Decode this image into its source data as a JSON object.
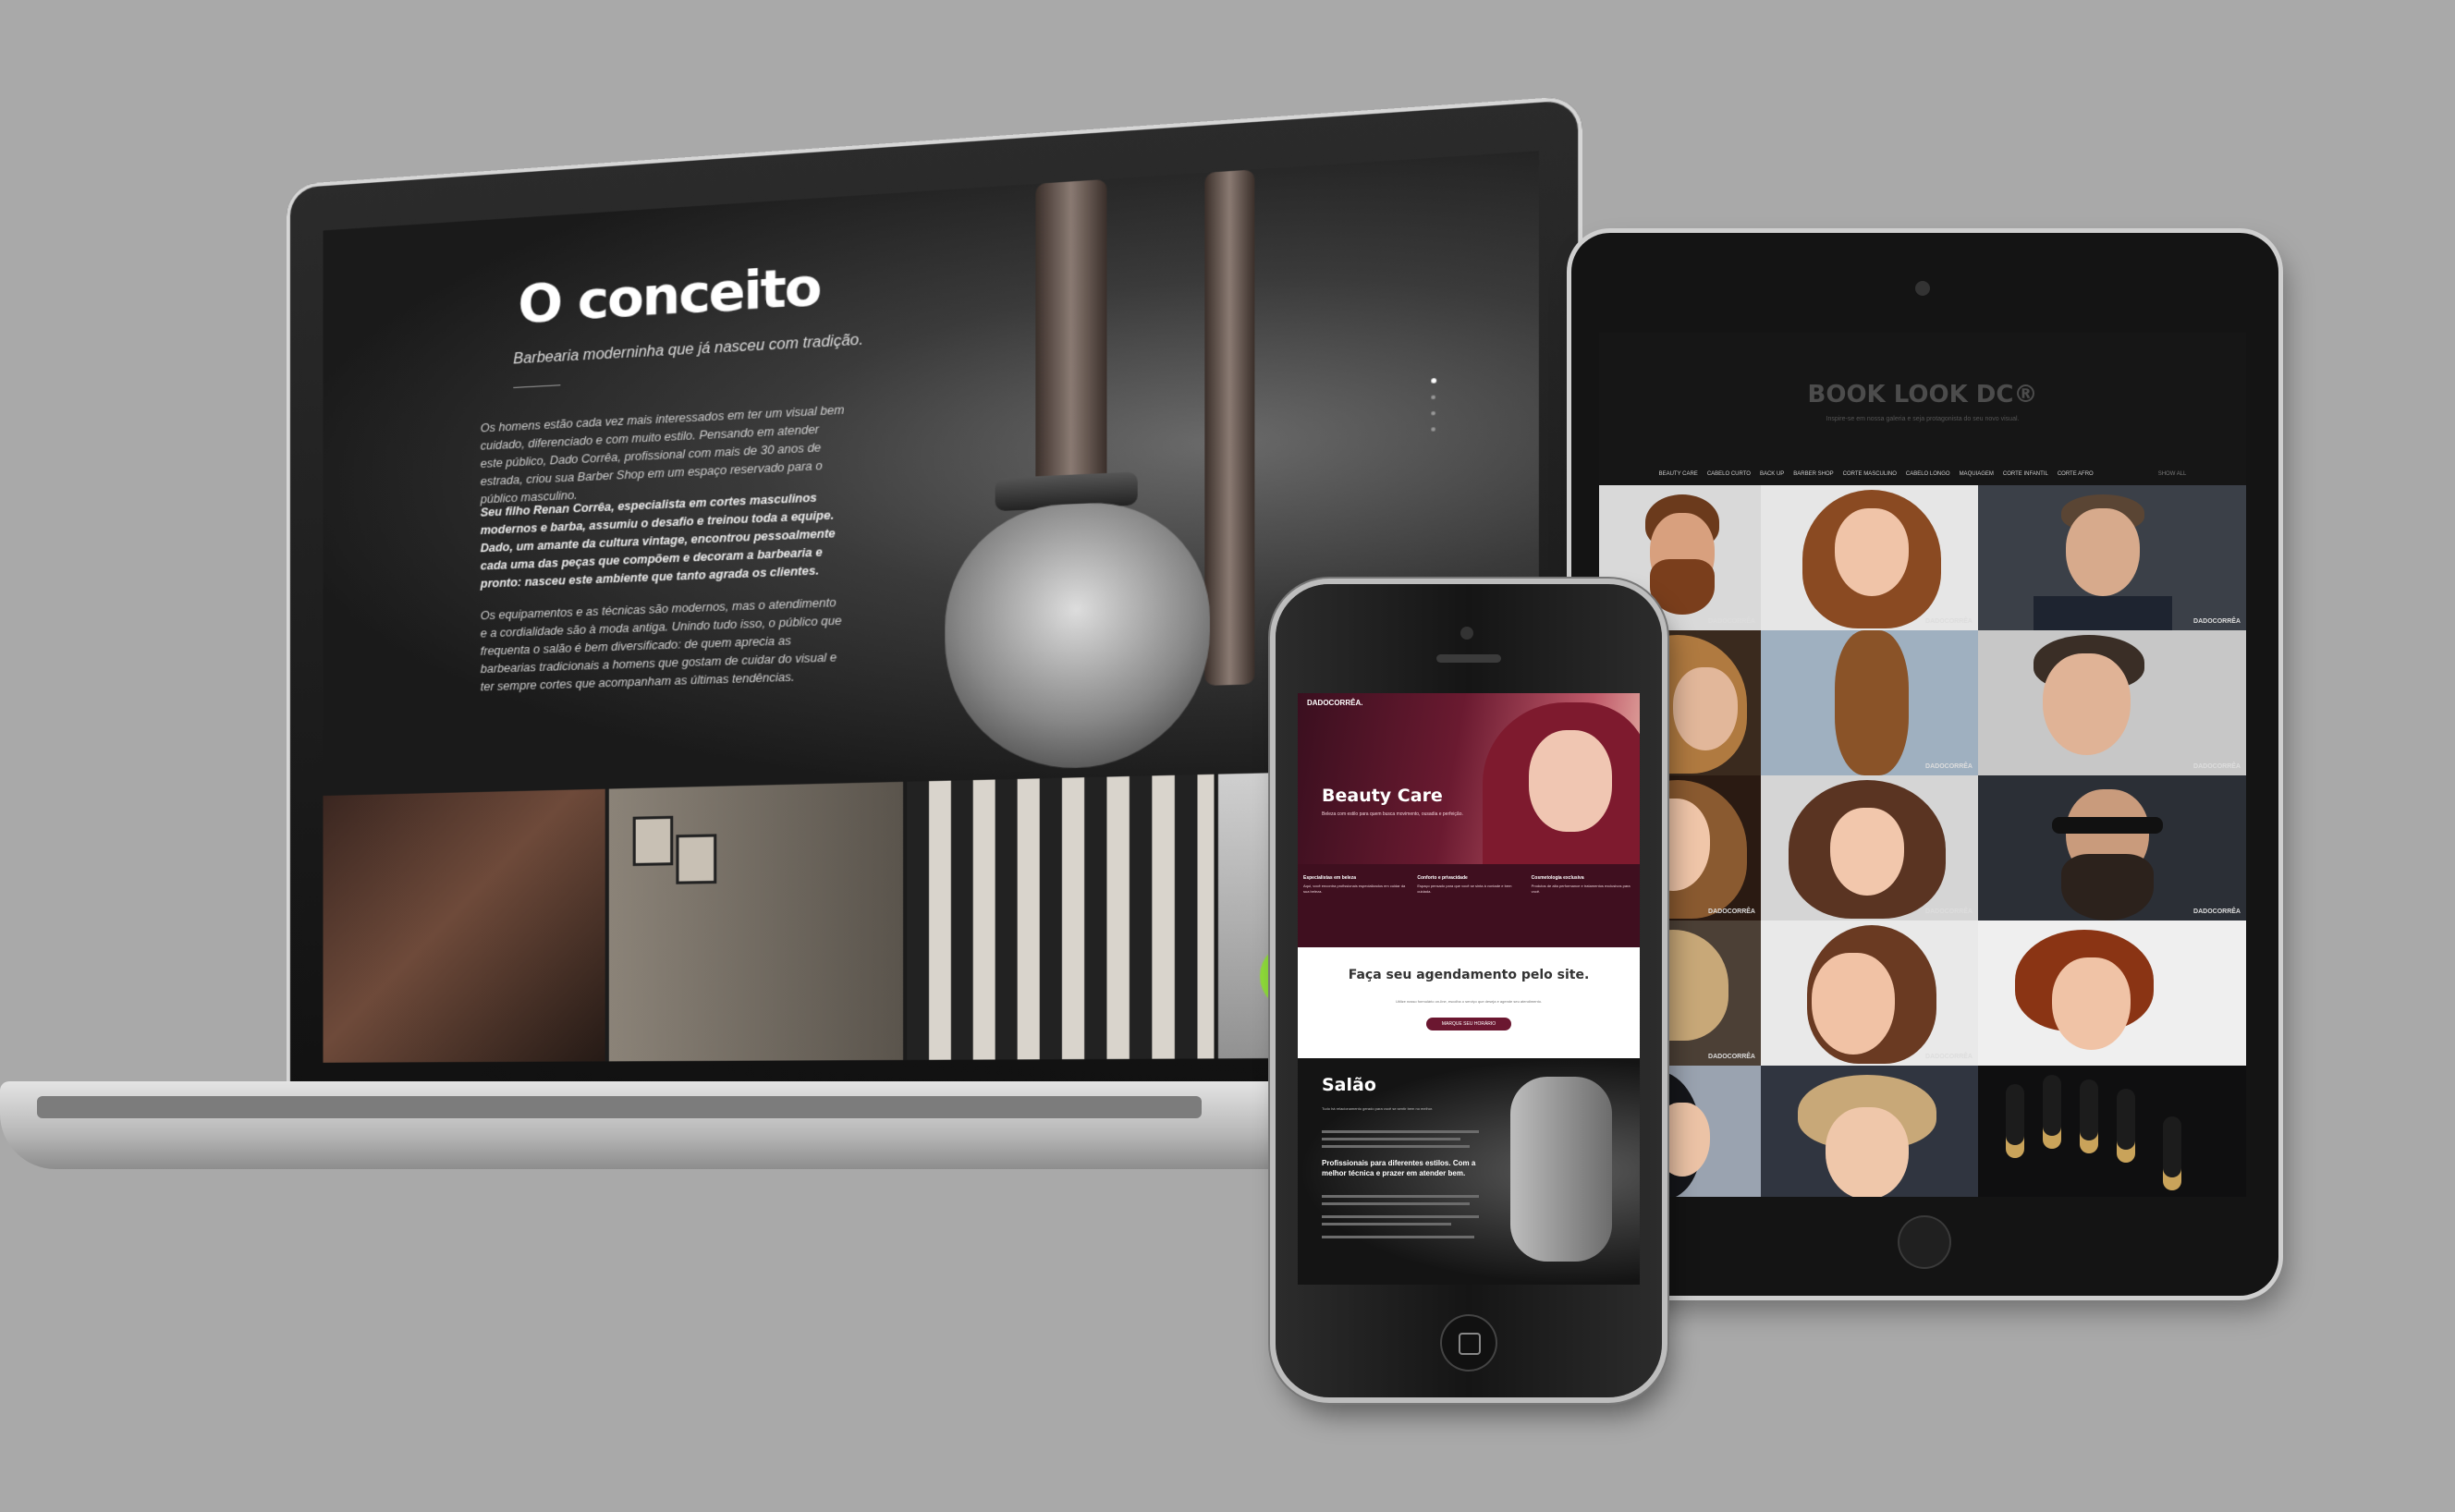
{
  "laptop": {
    "title": "O conceito",
    "subtitle": "Barbearia moderninha que já nasceu com tradição.",
    "paragraphs": [
      "Os homens estão cada vez mais interessados em ter um visual bem cuidado, diferenciado e com muito estilo. Pensando em atender este público, Dado Corrêa, profissional com mais de 30 anos de estrada, criou sua Barber Shop em um espaço reservado para o público masculino.",
      "Seu filho Renan Corrêa, especialista em cortes masculinos modernos e barba, assumiu o desafio e treinou toda a equipe. Dado, um amante da cultura vintage, encontrou pessoalmente cada uma das peças que compõem e decoram a barbearia e pronto: nasceu este ambiente que tanto agrada os clientes.",
      "Os equipamentos e as técnicas são modernos, mas o atendimento e a cordialidade são à moda antiga. Unindo tudo isso, o público que frequenta o salão é bem diversificado: de quem aprecia as barbearias tradicionais a homens que gostam de cuidar do visual e ter sempre cortes que acompanham as últimas tendências."
    ]
  },
  "tablet": {
    "title": "BOOK LOOK DC®",
    "subtitle": "Inspire-se em nossa galeria e seja protagonista do seu novo visual.",
    "nav": [
      "BEAUTY CARE",
      "CABELO CURTO",
      "BACK UP",
      "BARBER SHOP",
      "CORTE MASCULINO",
      "CABELO LONGO",
      "MAQUIAGEM",
      "CORTE INFANTIL",
      "CORTE AFRO",
      "SHOW ALL"
    ],
    "watermark": "DADOCORRÊA"
  },
  "phone": {
    "logo": "DADOCORRÊA.",
    "hero_title": "Beauty Care",
    "hero_sub": "Beleza com estilo para quem busca movimento, ousadia e perfeição.",
    "features": [
      {
        "title": "Especialistas em beleza",
        "desc": "Aqui, você encontra profissionais especializados em cuidar da sua beleza."
      },
      {
        "title": "Conforto e privacidade",
        "desc": "Espaço pensado para que você se sinta à vontade e bem cuidada."
      },
      {
        "title": "Cosmetologia exclusiva",
        "desc": "Produtos de alta performance e tratamentos exclusivos para você."
      }
    ],
    "cta_title": "Faça seu agendamento pelo site.",
    "cta_sub": "Utilize nosso formulário on-line, escolha o serviço que deseja e agende seu atendimento.",
    "cta_button": "MARQUE SEU HORÁRIO",
    "salao_title": "Salão",
    "salao_sub": "Tudo há relacionamento gerado para você se sentir bem no melhor.",
    "salao_bold": "Profissionais para diferentes estilos. Com a melhor técnica e prazer em atender bem."
  },
  "colors": {
    "background": "#a9a9a9",
    "wine": "#3f0f1f",
    "accent": "#6b1730"
  }
}
